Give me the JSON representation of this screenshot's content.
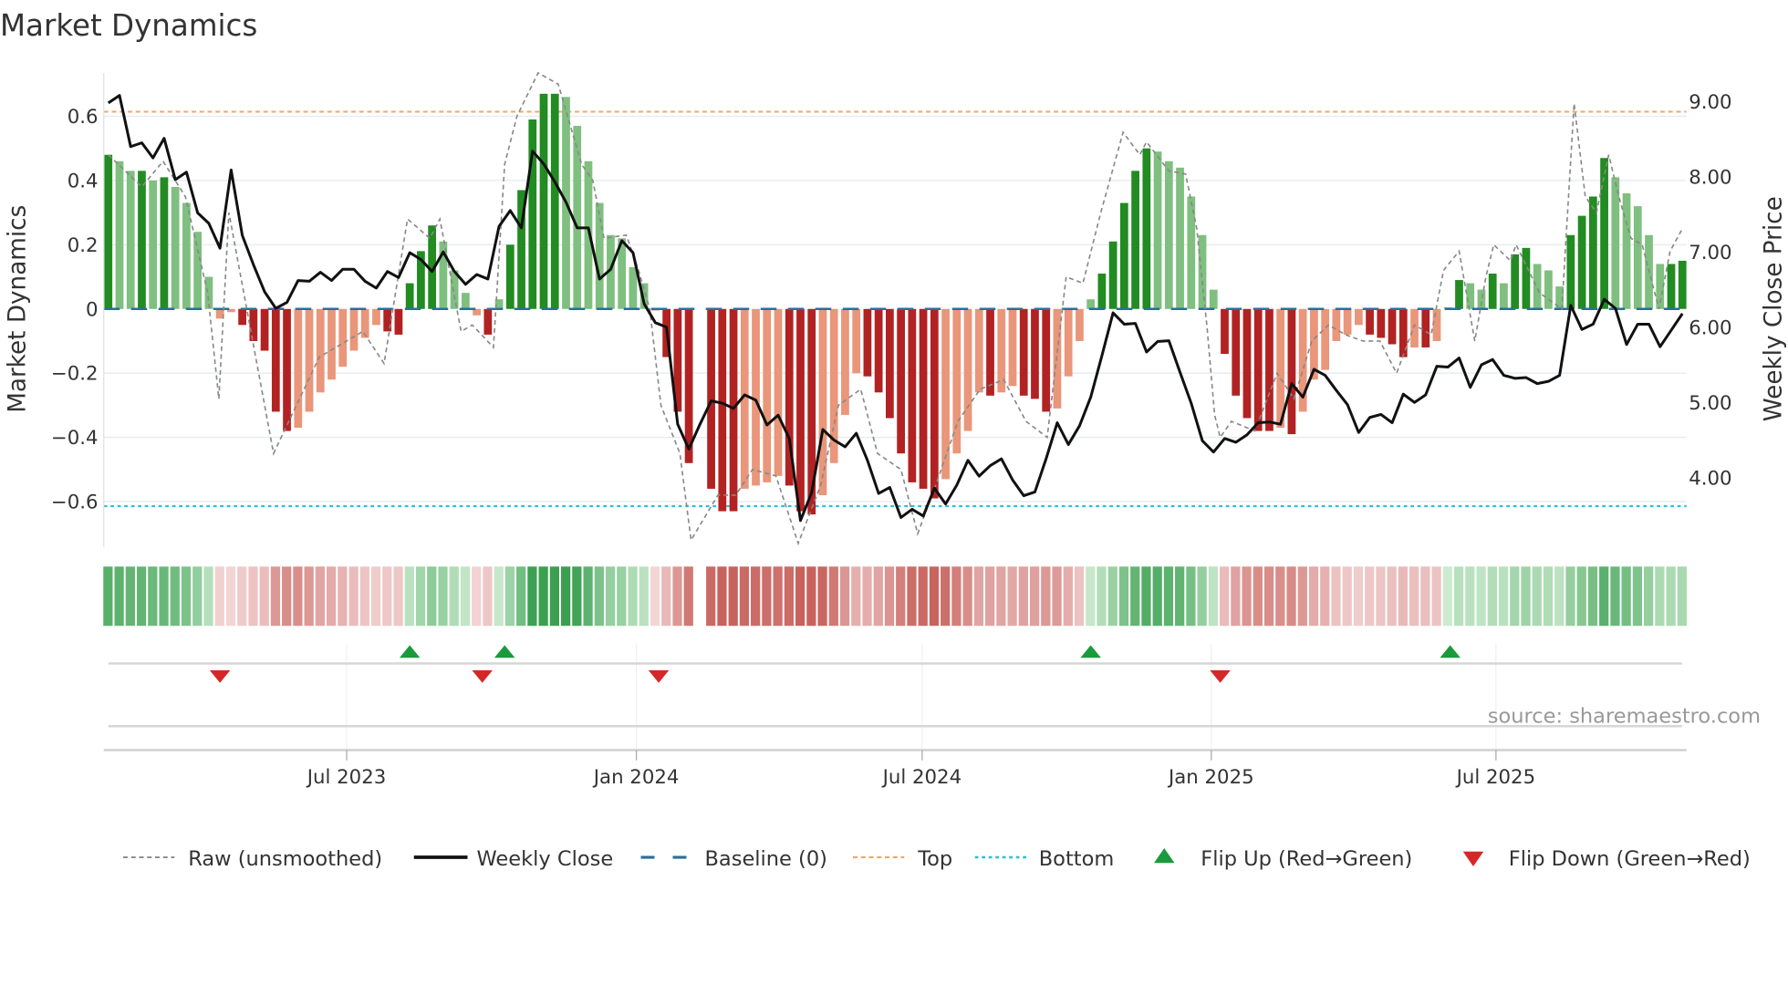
{
  "title": "Market Dynamics",
  "source": "source: sharemaestro.com",
  "colors": {
    "bar_pos_strong": "#228b22",
    "bar_pos_weak": "#7fbf7f",
    "bar_neg_strong": "#b22222",
    "bar_neg_weak": "#e9967a",
    "close": "#111111",
    "raw": "#888888",
    "baseline": "#2a6f97",
    "top": "#f0a868",
    "bottom": "#22c4d8",
    "flip_up": "#1a9a3a",
    "flip_down": "#d62728"
  },
  "chart_data": {
    "type": "bar",
    "title": "Market Dynamics",
    "xlabel": "",
    "ylabel": "Market Dynamics",
    "y2label": "Weekly Close Price",
    "x_unit": "week index (weekly, ~Feb 2023 to Oct 2025)",
    "ylim": [
      -0.74,
      0.74
    ],
    "y2lim": [
      3.2,
      9.7
    ],
    "yticks": [
      {
        "v": 0.6,
        "label": "0.6"
      },
      {
        "v": 0.4,
        "label": "0.4"
      },
      {
        "v": 0.2,
        "label": "0.2"
      },
      {
        "v": 0,
        "label": "0"
      },
      {
        "v": -0.2,
        "label": "−0.2"
      },
      {
        "v": -0.4,
        "label": "−0.4"
      },
      {
        "v": -0.6,
        "label": "−0.6"
      }
    ],
    "y2ticks": [
      {
        "v": 9,
        "label": "9.00"
      },
      {
        "v": 8,
        "label": "8.00"
      },
      {
        "v": 7,
        "label": "7.00"
      },
      {
        "v": 6,
        "label": "6.00"
      },
      {
        "v": 5,
        "label": "5.00"
      },
      {
        "v": 4,
        "label": "4.00"
      }
    ],
    "xticks": [
      {
        "week": 21.35,
        "label": "Jul 2023"
      },
      {
        "week": 47.3,
        "label": "Jan 2024"
      },
      {
        "week": 72.9,
        "label": "Jul 2024"
      },
      {
        "week": 98.8,
        "label": "Jan 2025"
      },
      {
        "week": 124.3,
        "label": "Jul 2025"
      }
    ],
    "grid": true,
    "top_level": 0.614,
    "bottom_level": -0.614,
    "baseline": 0,
    "dynamics": [
      0.48,
      0.46,
      0.43,
      0.43,
      0.4,
      0.41,
      0.38,
      0.33,
      0.24,
      0.1,
      -0.03,
      -0.01,
      -0.05,
      -0.1,
      -0.13,
      -0.32,
      -0.38,
      -0.37,
      -0.32,
      -0.26,
      -0.22,
      -0.18,
      -0.13,
      -0.09,
      -0.05,
      -0.07,
      -0.08,
      0.08,
      0.18,
      0.26,
      0.21,
      0.12,
      0.05,
      -0.02,
      -0.08,
      0.03,
      0.2,
      0.37,
      0.59,
      0.67,
      0.67,
      0.66,
      0.57,
      0.46,
      0.33,
      0.23,
      0.22,
      0.13,
      0.08,
      -0.005,
      -0.15,
      -0.32,
      -0.48,
      null,
      -0.56,
      -0.63,
      -0.63,
      -0.56,
      -0.55,
      -0.54,
      -0.52,
      -0.55,
      -0.63,
      -0.64,
      -0.58,
      -0.48,
      -0.33,
      -0.2,
      -0.21,
      -0.26,
      -0.34,
      -0.45,
      -0.54,
      -0.56,
      -0.59,
      -0.53,
      -0.45,
      -0.38,
      -0.26,
      -0.27,
      -0.26,
      -0.24,
      -0.27,
      -0.28,
      -0.32,
      -0.31,
      -0.21,
      -0.1,
      0.03,
      0.11,
      0.21,
      0.33,
      0.43,
      0.5,
      0.49,
      0.46,
      0.44,
      0.35,
      0.23,
      0.06,
      -0.14,
      -0.27,
      -0.34,
      -0.38,
      -0.38,
      -0.37,
      -0.39,
      -0.32,
      -0.22,
      -0.19,
      -0.1,
      -0.08,
      -0.05,
      -0.08,
      -0.09,
      -0.11,
      -0.15,
      -0.12,
      -0.12,
      -0.1,
      0.005,
      0.09,
      0.08,
      0.06,
      0.11,
      0.08,
      0.17,
      0.19,
      0.14,
      0.12,
      0.07,
      0.23,
      0.29,
      0.35,
      0.47,
      0.41,
      0.36,
      0.32,
      0.23,
      0.14,
      0.14,
      0.15
    ],
    "weekly_close": [
      8.98,
      9.08,
      8.4,
      8.45,
      8.25,
      8.51,
      7.96,
      8.06,
      7.52,
      7.38,
      7.05,
      8.09,
      7.22,
      6.83,
      6.47,
      6.25,
      6.33,
      6.62,
      6.61,
      6.73,
      6.62,
      6.77,
      6.77,
      6.61,
      6.52,
      6.74,
      6.66,
      6.99,
      6.9,
      6.74,
      7.0,
      6.74,
      6.57,
      6.7,
      6.64,
      7.34,
      7.55,
      7.32,
      8.34,
      8.17,
      7.93,
      7.66,
      7.32,
      7.32,
      6.64,
      6.77,
      7.15,
      6.99,
      6.31,
      6.06,
      6.0,
      4.71,
      4.38,
      4.71,
      5.02,
      4.99,
      4.92,
      5.1,
      5.03,
      4.7,
      4.83,
      4.52,
      3.43,
      3.8,
      4.64,
      4.5,
      4.41,
      4.59,
      4.23,
      3.79,
      3.87,
      3.47,
      3.58,
      3.49,
      3.86,
      3.65,
      3.9,
      4.23,
      4.02,
      4.16,
      4.25,
      3.97,
      3.76,
      3.81,
      4.25,
      4.73,
      4.44,
      4.69,
      5.07,
      5.62,
      6.19,
      6.04,
      6.05,
      5.67,
      5.81,
      5.82,
      5.4,
      4.99,
      4.49,
      4.34,
      4.52,
      4.47,
      4.57,
      4.73,
      4.74,
      4.71,
      5.25,
      5.07,
      5.44,
      5.36,
      5.16,
      4.97,
      4.6,
      4.8,
      4.84,
      4.73,
      5.11,
      5.0,
      5.1,
      5.48,
      5.47,
      5.59,
      5.2,
      5.5,
      5.57,
      5.36,
      5.32,
      5.33,
      5.25,
      5.28,
      5.36,
      6.29,
      5.97,
      6.04,
      6.37,
      6.25,
      5.77,
      6.04,
      6.04,
      5.74,
      5.96,
      6.18
    ],
    "raw": [
      [
        0,
        0.48
      ],
      [
        0.9,
        0.45
      ],
      [
        3,
        0.38
      ],
      [
        4.9,
        0.46
      ],
      [
        6.9,
        0.35
      ],
      [
        8.9,
        0.05
      ],
      [
        9.9,
        -0.28
      ],
      [
        10.8,
        0.3
      ],
      [
        14.8,
        -0.45
      ],
      [
        18.9,
        -0.15
      ],
      [
        22.8,
        -0.07
      ],
      [
        24.7,
        -0.17
      ],
      [
        26.8,
        0.28
      ],
      [
        28.8,
        0.22
      ],
      [
        29.7,
        0.28
      ],
      [
        31.6,
        -0.07
      ],
      [
        32.6,
        -0.05
      ],
      [
        34.5,
        -0.12
      ],
      [
        35.5,
        0.45
      ],
      [
        36.6,
        0.6
      ],
      [
        38.5,
        0.75
      ],
      [
        40.3,
        0.7
      ],
      [
        42.4,
        0.45
      ],
      [
        43.4,
        0.4
      ],
      [
        44.4,
        0.22
      ],
      [
        46.4,
        0.23
      ],
      [
        47.5,
        0.12
      ],
      [
        48.5,
        0.0
      ],
      [
        49.5,
        -0.3
      ],
      [
        51.2,
        -0.45
      ],
      [
        52.2,
        -0.72
      ],
      [
        54.6,
        -0.58
      ],
      [
        56.2,
        -0.58
      ],
      [
        57.7,
        -0.5
      ],
      [
        59.8,
        -0.52
      ],
      [
        61.8,
        -0.73
      ],
      [
        63.8,
        -0.55
      ],
      [
        65.4,
        -0.3
      ],
      [
        67.4,
        -0.25
      ],
      [
        68.9,
        -0.45
      ],
      [
        71,
        -0.5
      ],
      [
        72.5,
        -0.7
      ],
      [
        74.1,
        -0.55
      ],
      [
        76.1,
        -0.35
      ],
      [
        78.1,
        -0.25
      ],
      [
        80.2,
        -0.22
      ],
      [
        82.2,
        -0.35
      ],
      [
        84.1,
        -0.4
      ],
      [
        85.8,
        0.1
      ],
      [
        87.3,
        0.08
      ],
      [
        88.9,
        0.3
      ],
      [
        90.9,
        0.55
      ],
      [
        92.4,
        0.48
      ],
      [
        93,
        0.52
      ],
      [
        95,
        0.43
      ],
      [
        96.5,
        0.42
      ],
      [
        97.5,
        0.25
      ],
      [
        98.4,
        -0.05
      ],
      [
        99.1,
        -0.33
      ],
      [
        99.6,
        -0.4
      ],
      [
        100.6,
        -0.35
      ],
      [
        102.7,
        -0.38
      ],
      [
        104.7,
        -0.2
      ],
      [
        106.2,
        -0.28
      ],
      [
        107.8,
        -0.1
      ],
      [
        109.3,
        -0.05
      ],
      [
        110.8,
        -0.08
      ],
      [
        112.4,
        -0.1
      ],
      [
        113.9,
        -0.1
      ],
      [
        115.4,
        -0.2
      ],
      [
        117,
        -0.05
      ],
      [
        118.5,
        -0.08
      ],
      [
        119.6,
        0.12
      ],
      [
        121,
        0.18
      ],
      [
        122.4,
        -0.1
      ],
      [
        123.4,
        0.1
      ],
      [
        124.1,
        0.2
      ],
      [
        125.6,
        0.15
      ],
      [
        126.1,
        0.2
      ],
      [
        128.2,
        0.05
      ],
      [
        130.2,
        0.0
      ],
      [
        131.3,
        0.64
      ],
      [
        132.3,
        0.35
      ],
      [
        133.3,
        0.3
      ],
      [
        134.4,
        0.48
      ],
      [
        135.3,
        0.35
      ],
      [
        136.4,
        0.22
      ],
      [
        137.4,
        0.2
      ],
      [
        138.9,
        0.0
      ],
      [
        139.9,
        0.18
      ],
      [
        141,
        0.25
      ]
    ],
    "flip_up_weeks": [
      27,
      35.5,
      88,
      120.2
    ],
    "flip_down_weeks": [
      10,
      33.5,
      49.3,
      99.6
    ]
  },
  "legend": {
    "raw": "Raw (unsmoothed)",
    "close": "Weekly Close",
    "baseline": "Baseline (0)",
    "top": "Top",
    "bottom": "Bottom",
    "flip_up": "Flip Up (Red→Green)",
    "flip_down": "Flip Down (Green→Red)"
  }
}
